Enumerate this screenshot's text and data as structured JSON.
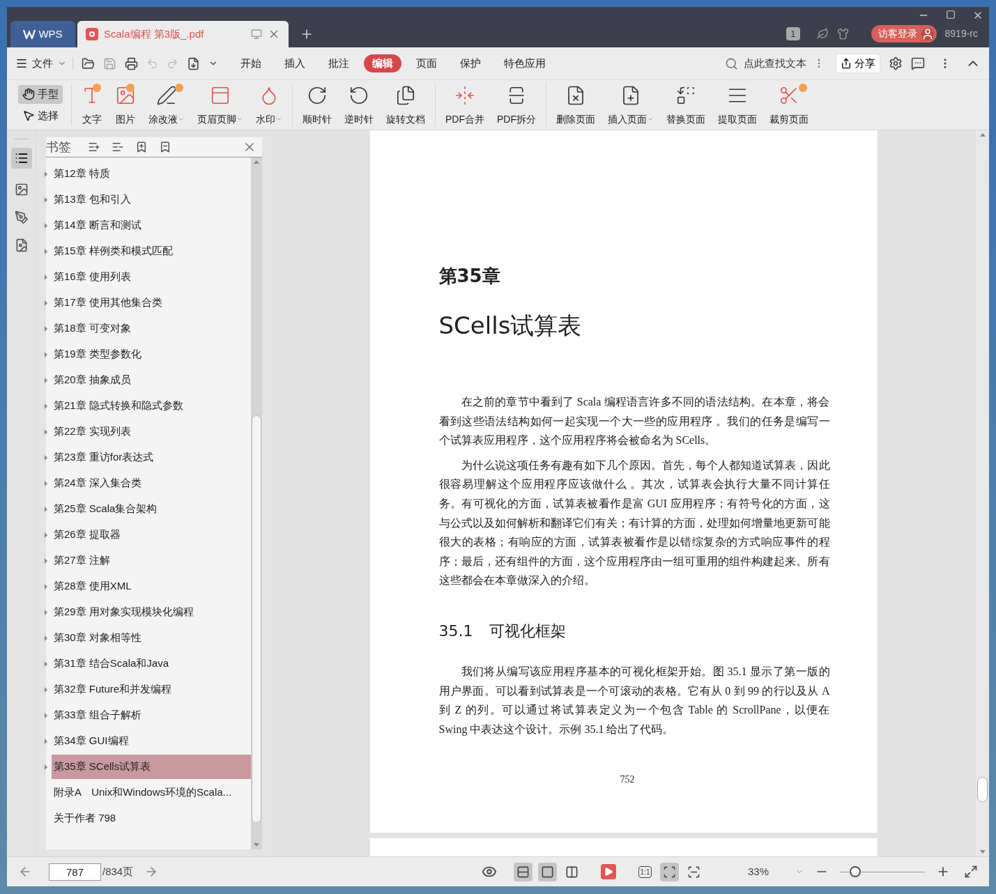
{
  "app_tab": {
    "label": "WPS"
  },
  "doc_tab": {
    "label": "Scala编程 第3版_.pdf"
  },
  "title_bar": {
    "badge": "1",
    "login": "访客登录",
    "user": "8919-rc"
  },
  "menu": {
    "file": "文件",
    "tabs": [
      {
        "label": "开始",
        "selected": false
      },
      {
        "label": "插入",
        "selected": false
      },
      {
        "label": "批注",
        "selected": false
      },
      {
        "label": "编辑",
        "selected": true
      },
      {
        "label": "页面",
        "selected": false
      },
      {
        "label": "保护",
        "selected": false
      },
      {
        "label": "特色应用",
        "selected": false
      }
    ],
    "search": {
      "placeholder": "点此查找文本"
    },
    "share": "分享"
  },
  "ribbon": {
    "modes": [
      {
        "label": "手型",
        "selected": true
      },
      {
        "label": "选择",
        "selected": false
      }
    ],
    "groups": [
      [
        {
          "label": "文字",
          "dropdown": false,
          "badge": true
        },
        {
          "label": "图片",
          "dropdown": false,
          "badge": true
        },
        {
          "label": "涂改液",
          "dropdown": true,
          "badge": true
        },
        {
          "label": "页眉页脚",
          "dropdown": true,
          "badge": false
        },
        {
          "label": "水印",
          "dropdown": true,
          "badge": false
        }
      ],
      [
        {
          "label": "顺时针",
          "dropdown": false,
          "badge": false
        },
        {
          "label": "逆时针",
          "dropdown": false,
          "badge": false
        },
        {
          "label": "旋转文档",
          "dropdown": false,
          "badge": false
        }
      ],
      [
        {
          "label": "PDF合并",
          "dropdown": false,
          "badge": false
        },
        {
          "label": "PDF拆分",
          "dropdown": false,
          "badge": false
        }
      ],
      [
        {
          "label": "删除页面",
          "dropdown": false,
          "badge": false
        },
        {
          "label": "插入页面",
          "dropdown": true,
          "badge": false
        },
        {
          "label": "替换页面",
          "dropdown": false,
          "badge": false
        },
        {
          "label": "提取页面",
          "dropdown": false,
          "badge": false
        },
        {
          "label": "裁剪页面",
          "dropdown": false,
          "badge": true
        }
      ]
    ]
  },
  "bookmarks": {
    "title": "书签",
    "items": [
      {
        "label": "第12章 特质",
        "expandable": true,
        "selected": false
      },
      {
        "label": "第13章 包和引入",
        "expandable": true,
        "selected": false
      },
      {
        "label": "第14章 断言和测试",
        "expandable": true,
        "selected": false
      },
      {
        "label": "第15章 样例类和模式匹配",
        "expandable": true,
        "selected": false
      },
      {
        "label": "第16章 使用列表",
        "expandable": true,
        "selected": false
      },
      {
        "label": "第17章 使用其他集合类",
        "expandable": true,
        "selected": false
      },
      {
        "label": "第18章 可变对象",
        "expandable": true,
        "selected": false
      },
      {
        "label": "第19章 类型参数化",
        "expandable": true,
        "selected": false
      },
      {
        "label": "第20章 抽象成员",
        "expandable": true,
        "selected": false
      },
      {
        "label": "第21章 隐式转换和隐式参数",
        "expandable": true,
        "selected": false
      },
      {
        "label": "第22章 实现列表",
        "expandable": true,
        "selected": false
      },
      {
        "label": "第23章 重访for表达式",
        "expandable": true,
        "selected": false
      },
      {
        "label": "第24章 深入集合类",
        "expandable": true,
        "selected": false
      },
      {
        "label": "第25章 Scala集合架构",
        "expandable": true,
        "selected": false
      },
      {
        "label": "第26章 提取器",
        "expandable": true,
        "selected": false
      },
      {
        "label": "第27章 注解",
        "expandable": true,
        "selected": false
      },
      {
        "label": "第28章 使用XML",
        "expandable": true,
        "selected": false
      },
      {
        "label": "第29章 用对象实现模块化编程",
        "expandable": true,
        "selected": false
      },
      {
        "label": "第30章 对象相等性",
        "expandable": true,
        "selected": false
      },
      {
        "label": "第31章 结合Scala和Java",
        "expandable": true,
        "selected": false
      },
      {
        "label": "第32章 Future和并发编程",
        "expandable": true,
        "selected": false
      },
      {
        "label": "第33章 组合子解析",
        "expandable": true,
        "selected": false
      },
      {
        "label": "第34章 GUI编程",
        "expandable": true,
        "selected": false
      },
      {
        "label": "第35章 SCells试算表",
        "expandable": true,
        "selected": true
      },
      {
        "label": "附录A　Unix和Windows环境的Scala...",
        "expandable": false,
        "selected": false
      },
      {
        "label": "关于作者 798",
        "expandable": false,
        "selected": false
      }
    ]
  },
  "page": {
    "chapter": "第35章",
    "title": "SCells试算表",
    "paragraphs": [
      "在之前的章节中看到了 Scala 编程语言许多不同的语法结构。在本章，将会看到这些语法结构如何一起实现一个大一些的应用程序 。我们的任务是编写一个试算表应用程序，这个应用程序将会被命名为 SCells。",
      "为什么说这项任务有趣有如下几个原因。首先，每个人都知道试算表，因此很容易理解这个应用程序应该做什么 。其次，试算表会执行大量不同计算任务。有可视化的方面，试算表被看作是富 GUI 应用程序；有符号化的方面，这与公式以及如何解析和翻译它们有关；有计算的方面，处理如何增量地更新可能很大的表格；有响应的方面，试算表被看作是以错综复杂的方式响应事件的程序；最后，还有组件的方面，这个应用程序由一组可重用的组件构建起来。所有这些都会在本章做深入的介绍。"
    ],
    "section": {
      "number": "35.1",
      "title": "可视化框架"
    },
    "section_paragraphs": [
      "我们将从编写该应用程序基本的可视化框架开始。图 35.1 显示了第一版的用户界面。可以看到试算表是一个可滚动的表格。它有从 0 到 99 的行以及从 A 到 Z 的列。可以通过将试算表定义为一个包含 Table 的 ScrollPane，以便在 Swing 中表达这个设计。示例 35.1 给出了代码。"
    ],
    "page_number": "752"
  },
  "status_bar": {
    "page_input": "787",
    "page_total": "/834页",
    "layouts": [
      {
        "selected": true
      },
      {
        "selected": true
      },
      {
        "selected": false
      }
    ],
    "fits": [
      {
        "kind": "actual",
        "label": "1:1",
        "selected": false
      },
      {
        "kind": "fit",
        "selected": true
      },
      {
        "kind": "width",
        "selected": false
      }
    ],
    "zoom": "33%",
    "zoom_slider": {
      "level": 0.18
    }
  }
}
